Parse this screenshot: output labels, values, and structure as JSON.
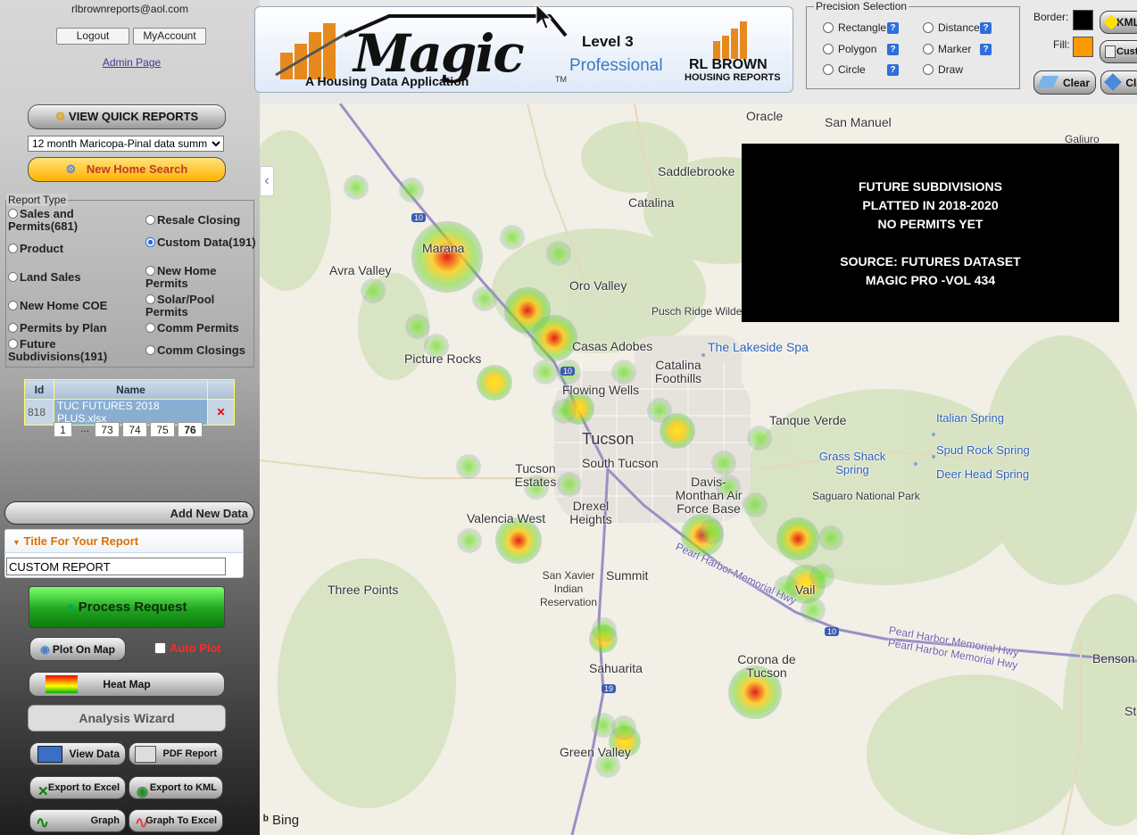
{
  "user": {
    "email": "rlbrownreports@aol.com",
    "logout": "Logout",
    "myaccount": "MyAccount",
    "admin": "Admin Page"
  },
  "quick_reports": {
    "button": "VIEW QUICK REPORTS",
    "selected": "12 month Maricopa-Pinal data summ",
    "new_home_search": "New Home Search"
  },
  "report_type": {
    "legend": "Report Type",
    "options": [
      {
        "label": "Sales and Permits(681)",
        "checked": false
      },
      {
        "label": "Resale Closing",
        "checked": false
      },
      {
        "label": "Product",
        "checked": false
      },
      {
        "label": "Custom Data(191)",
        "checked": true
      },
      {
        "label": "Land Sales",
        "checked": false
      },
      {
        "label": "New Home Permits",
        "checked": false
      },
      {
        "label": "New Home COE",
        "checked": false
      },
      {
        "label": "Solar/Pool Permits",
        "checked": false
      },
      {
        "label": "Permits by Plan",
        "checked": false
      },
      {
        "label": "Comm Permits",
        "checked": false
      },
      {
        "label": "Future Subdivisions(191)",
        "checked": false
      },
      {
        "label": "Comm Closings",
        "checked": false
      }
    ]
  },
  "data_table": {
    "headers": [
      "Id",
      "Name"
    ],
    "rows": [
      {
        "id": "818",
        "name": "TUC FUTURES 2018 PLUS.xlsx",
        "delete": "✕"
      }
    ]
  },
  "pagination": [
    "1",
    "...",
    "73",
    "74",
    "75",
    "76"
  ],
  "add_new_data": "Add New Data",
  "title_section": {
    "header": "Title For Your Report",
    "value": "CUSTOM REPORT"
  },
  "actions": {
    "process": "Process Request",
    "plot_on_map": "Plot On Map",
    "auto_plot": "Auto Plot",
    "heat_map": "Heat Map",
    "analysis_wizard": "Analysis Wizard",
    "view_data": "View Data",
    "pdf_report": "PDF Report",
    "export_excel": "Export to Excel",
    "export_kml": "Export to KML",
    "graph": "Graph",
    "graph_excel": "Graph To Excel"
  },
  "logo": {
    "brand": "Magic",
    "tagline": "A Housing Data Application",
    "tm": "TM",
    "level": "Level 3",
    "edition": "Professional",
    "company1": "RL BROWN",
    "company2": "HOUSING REPORTS"
  },
  "precision": {
    "legend": "Precision Selection",
    "options": [
      "Rectangle",
      "Distance",
      "Polygon",
      "Marker",
      "Circle",
      "Draw"
    ],
    "help": "?"
  },
  "style": {
    "border_label": "Border:",
    "fill_label": "Fill:",
    "border_color": "#000000",
    "fill_color": "#ff9900",
    "kml": "KML",
    "custom": "Custo",
    "clear1": "Clear",
    "clear2": "Cle"
  },
  "map": {
    "overlay": [
      "FUTURE  SUBDIVISIONS",
      "PLATTED IN 2018-2020",
      "NO PERMITS YET",
      "",
      "SOURCE: FUTURES DATASET",
      "MAGIC PRO -VOL 434"
    ],
    "attribution": "Bing",
    "labels": [
      "Oracle",
      "San Manuel",
      "Galiuro",
      "Saddlebrooke",
      "Catalina",
      "Marana",
      "Avra Valley",
      "Oro Valley",
      "Pusch Ridge Wilde",
      "Casas Adobes",
      "The Lakeside Spa",
      "Picture Rocks",
      "Catalina Foothills",
      "Flowing Wells",
      "Tanque Verde",
      "Italian Spring",
      "Tucson",
      "South Tucson",
      "Spud Rock Spring",
      "Grass Shack Spring",
      "Deer Head Spring",
      "Tucson Estates",
      "Davis-Monthan Air Force Base",
      "Saguaro National Park",
      "Drexel Heights",
      "Valencia West",
      "Three Points",
      "San Xavier Indian Reservation",
      "Summit",
      "Vail",
      "Pearl Harbor Memorial Hwy",
      "Pearl Harbor Memorial Hwy",
      "Benson",
      "Corona de Tucson",
      "Sahuarita",
      "Green Valley",
      "Pearl Harbor Memorial Hwy",
      "St",
      "10",
      "10",
      "10",
      "19"
    ],
    "heat_points": [
      {
        "level": 0.92
      },
      {
        "level": 0.88
      },
      {
        "level": 0.85
      },
      {
        "level": 0.8
      },
      {
        "level": 0.9
      },
      {
        "level": 0.9
      },
      {
        "level": 0.9
      },
      {
        "level": 0.6
      },
      {
        "level": 0.5
      },
      {
        "level": 0.5
      },
      {
        "level": 0.45
      },
      {
        "level": 0.45
      },
      {
        "level": 0.45
      }
    ]
  }
}
